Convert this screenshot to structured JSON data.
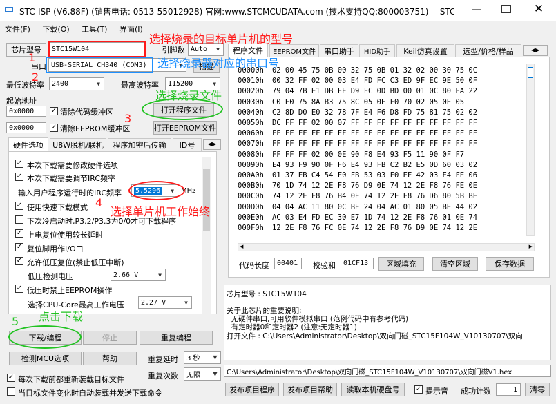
{
  "window": {
    "title": "STC-ISP (V6.88F) (销售电话: 0513-55012928) 官网:www.STCMCUDATA.com  (技术支持QQ:800003751) -- STC: ...",
    "min_icon": "minimize-icon",
    "max_icon": "maximize-icon",
    "close_icon": "close-icon"
  },
  "menu": [
    "文件(F)",
    "下载(O)",
    "工具(T)",
    "界面(I)"
  ],
  "left": {
    "chip_label": "芯片型号",
    "chip_value": "STC15W104",
    "pin_label": "引脚数",
    "pin_value": "Auto",
    "port_label": "串口",
    "port_value": "USB-SERIAL CH340 (COM3)",
    "scan_button": "扫描",
    "min_baud_label": "最低波特率",
    "min_baud_value": "2400",
    "max_baud_label": "最高波特率",
    "max_baud_value": "115200",
    "start_addr_label": "起始地址",
    "addr1": "0x0000",
    "clear_code_label": "清除代码缓冲区",
    "open_prog_button": "打开程序文件",
    "addr2": "0x0000",
    "clear_eeprom_label": "清除EEPROM缓冲区",
    "open_eeprom_button": "打开EEPROM文件",
    "tabs": [
      "硬件选项",
      "U8W脱机/联机",
      "程序加密后传输",
      "ID号"
    ],
    "options": [
      {
        "label": "本次下载需要修改硬件选项",
        "checked": true
      },
      {
        "label": "本次下载需要调节IRC频率",
        "checked": true
      }
    ],
    "irc_label": "输入用户程序运行时的IRC频率",
    "irc_value": "5.5296",
    "irc_unit": "MHz",
    "options2": [
      {
        "label": "使用快速下载模式",
        "checked": true
      },
      {
        "label": "下次冷启动时,P3.2/P3.3为0/0才可下载程序",
        "checked": false
      },
      {
        "label": "上电复位使用较长延时",
        "checked": true
      },
      {
        "label": "复位脚用作I/O口",
        "checked": true
      },
      {
        "label": "允许低压复位(禁止低压中断)",
        "checked": true
      }
    ],
    "lv_label": "低压检测电压",
    "lv_value": "2.66 V",
    "eeprom_opt": {
      "label": "低压时禁止EEPROM操作",
      "checked": true
    },
    "core_label": "选择CPU-Core最高工作电压",
    "core_value": "2.27 V",
    "download_button": "下载/编程",
    "stop_button": "停止",
    "reprogram_button": "重复编程",
    "detect_button": "检测MCU选项",
    "help_button": "帮助",
    "delay_label": "重复延时",
    "delay_value": "3 秒",
    "reload_label": "每次下载前都重新装载目标文件",
    "reload_checked": true,
    "count_label": "重复次数",
    "count_value": "无限",
    "auto_label": "当目标文件变化时自动装载并发送下载命令",
    "auto_checked": false
  },
  "right": {
    "tabs": [
      "程序文件",
      "EEPROM文件",
      "串口助手",
      "HID助手",
      "Keil仿真设置",
      "选型/价格/样品"
    ],
    "hex_rows": [
      {
        "addr": "00000h",
        "bytes": "02 00 45 75 0B 00 32 75 0B 01 32 02 00 30 75 0C"
      },
      {
        "addr": "00010h",
        "bytes": "00 32 FF 02 00 03 E4 FD FC C3 ED 9F EC 9E 50 0F"
      },
      {
        "addr": "00020h",
        "bytes": "79 04 7B E1 DB FE D9 FC 0D BD 00 01 0C 80 EA 22"
      },
      {
        "addr": "00030h",
        "bytes": "C0 E0 75 8A B3 75 8C 05 0E F0 70 02 05 0E 05"
      },
      {
        "addr": "00040h",
        "bytes": "C2 8D D0 E0 32 78 7F E4 F6 D8 FD 75 81 75 02 02"
      },
      {
        "addr": "00050h",
        "bytes": "DC FF FF 02 00 07 FF FF FF FF FF FF FF FF FF FF"
      },
      {
        "addr": "00060h",
        "bytes": "FF FF FF FF FF FF FF FF FF FF FF FF FF FF FF FF"
      },
      {
        "addr": "00070h",
        "bytes": "FF FF FF FF FF FF FF FF FF FF FF FF FF FF FF FF"
      },
      {
        "addr": "00080h",
        "bytes": "FF FF FF 02 00 0E 90 F8 E4 93 F5 11 90 0F F7"
      },
      {
        "addr": "00090h",
        "bytes": "E4 93 F9 90 0F F6 E4 93 FB C2 B2 E5 0D 60 03 02"
      },
      {
        "addr": "000A0h",
        "bytes": "01 37 EB C4 54 F0 FB 53 03 F0 EF 42 03 E4 FE 06"
      },
      {
        "addr": "000B0h",
        "bytes": "70 1D 74 12 2E F8 76 D9 0E 74 12 2E F8 76 FE 0E"
      },
      {
        "addr": "000C0h",
        "bytes": "74 12 2E F8 76 B4 0E 74 12 2E F8 76 D6 80 5B BE"
      },
      {
        "addr": "000D0h",
        "bytes": "04 04 AC 11 80 0C BE 24 04 AC 01 80 05 BE 44 02"
      },
      {
        "addr": "000E0h",
        "bytes": "AC 03 E4 FD EC 30 E7 1D 74 12 2E F8 76 01 0E 74"
      },
      {
        "addr": "000F0h",
        "bytes": "12 2E F8 76 FC 0E 74 12 2E F8 76 D9 0E 74 12 2E"
      }
    ],
    "code_len_label": "代码长度",
    "code_len_value": "00401",
    "checksum_label": "校验和",
    "checksum_value": "01CF13",
    "fill_button": "区域填充",
    "clear_button": "清空区域",
    "save_button": "保存数据",
    "info_lines": [
      "芯片型号 : STC15W104",
      "",
      "关于此芯片的重要说明:",
      "  无硬件串口,可用软件模拟串口 (范例代码中有参考代码)",
      "  有定时器0和定时器2 (注意:无定时器1)",
      "打开文件 : C:\\Users\\Administrator\\Desktop\\双向门磁_STC15F104W_V10130707\\双向"
    ],
    "path_value": "C:\\Users\\Administrator\\Desktop\\双向门磁_STC15F104W_V10130707\\双向门磁V1.hex",
    "publish_prog_button": "发布项目程序",
    "publish_help_button": "发布项目帮助",
    "read_serial_button": "读取本机硬盘号",
    "tone_label": "提示音",
    "tone_checked": true,
    "success_label": "成功计数",
    "success_value": "1",
    "clear_count_button": "清零"
  },
  "annotations": {
    "n1": "1",
    "t1": "选择烧录的目标单片机的型号",
    "n2": "2",
    "t2": "选择烧录器对应的串口号",
    "t3": "选择烧录文件",
    "n3": "3",
    "n4": "4",
    "t4": "选择单片机工作始终",
    "n5": "5",
    "t5": "点击下载"
  },
  "colors": {
    "annotation_red": "#ff1a1a",
    "annotation_blue": "#1e90ff",
    "annotation_green": "#22c322"
  }
}
